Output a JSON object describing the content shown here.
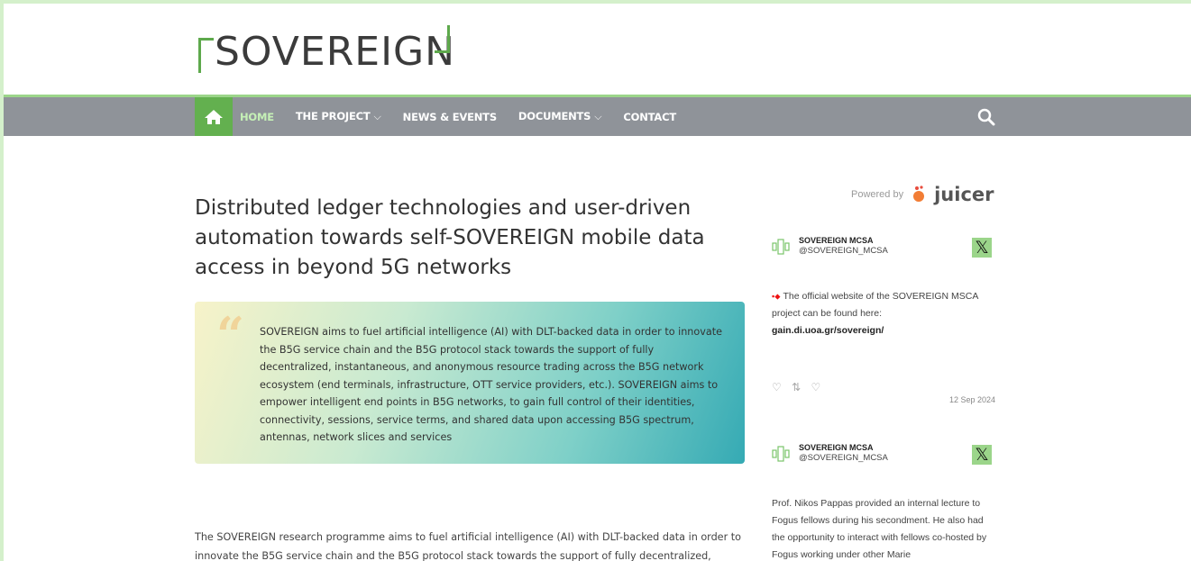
{
  "brand": {
    "logo_text": "SOVEREIGN",
    "accent": "#63b04f",
    "nav_bg": "#8f9399"
  },
  "nav": {
    "home_icon": "home-icon",
    "items": [
      {
        "label": "HOME",
        "active": true
      },
      {
        "label": "THE PROJECT",
        "dropdown": true
      },
      {
        "label": "NEWS & EVENTS"
      },
      {
        "label": "DOCUMENTS",
        "dropdown": true
      },
      {
        "label": "CONTACT"
      }
    ],
    "search_icon": "search-icon"
  },
  "main": {
    "title": "Distributed ledger technologies and user-driven automation towards self-SOVEREIGN mobile data access in beyond 5G networks",
    "quote": "SOVEREIGN aims to fuel artificial intelligence (AI) with DLT-backed data in order to innovate the B5G service chain and the B5G protocol stack towards the support of fully decentralized, instantaneous, and anonymous resource trading across the B5G network ecosystem (end terminals, infrastructure, OTT service providers, etc.). SOVEREIGN aims to empower intelligent end points in B5G networks, to gain full control of their identities, connectivity, sessions, service terms, and shared data upon accessing B5G spectrum, antennas, network slices and services",
    "body": "The SOVEREIGN research programme aims to fuel artificial intelligence (AI) with DLT-backed data in order to innovate the B5G service chain and the B5G protocol stack towards the support of fully decentralized, instantaneous, and"
  },
  "feed": {
    "powered_by": "Powered by",
    "juicer": "juicer",
    "posts": [
      {
        "name": "SOVEREIGN MCSA",
        "handle": "@SOVEREIGN_MCSA",
        "text": "The official website of the SOVEREIGN MSCA project can be found here:",
        "link": "gain.di.uoa.gr/sovereign/",
        "actions": "♡ ⇄ ♡",
        "date": "12 Sep 2024"
      },
      {
        "name": "SOVEREIGN MCSA",
        "handle": "@SOVEREIGN_MCSA",
        "text": "Prof. Nikos Pappas provided an internal lecture to Fogus fellows during his secondment. He also had the opportunity to interact with fellows co-hosted by Fogus working under other Marie"
      }
    ]
  }
}
